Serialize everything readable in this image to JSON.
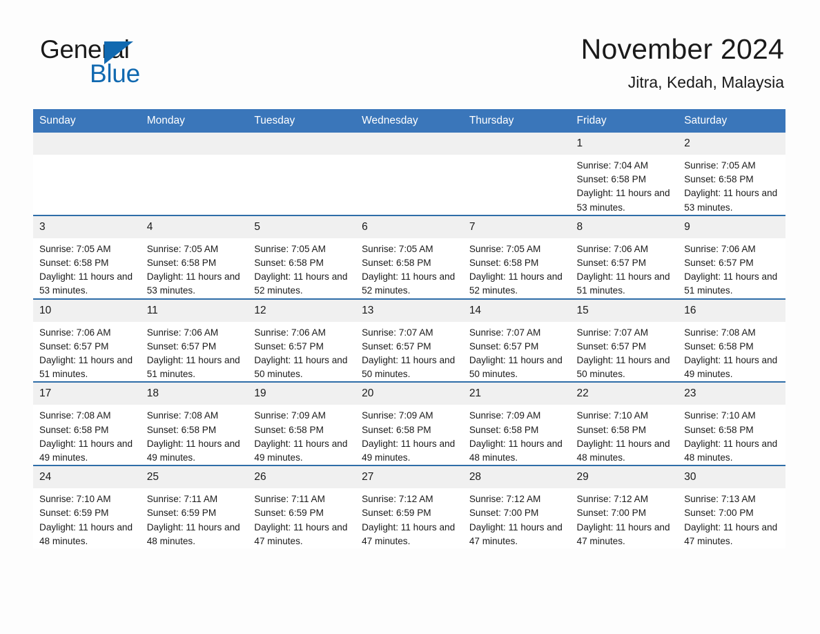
{
  "brand": {
    "name_part1": "General",
    "name_part2": "Blue",
    "logo_icon": "triangle-icon",
    "accent_color": "#1169b0"
  },
  "header": {
    "title": "November 2024",
    "subtitle": "Jitra, Kedah, Malaysia"
  },
  "colors": {
    "header_blue": "#3a76ba",
    "row_rule_blue": "#2e6da8",
    "daynum_band": "#f0f0f0"
  },
  "weekday_headers": [
    "Sunday",
    "Monday",
    "Tuesday",
    "Wednesday",
    "Thursday",
    "Friday",
    "Saturday"
  ],
  "weeks": [
    [
      {
        "day": "",
        "empty": true
      },
      {
        "day": "",
        "empty": true
      },
      {
        "day": "",
        "empty": true
      },
      {
        "day": "",
        "empty": true
      },
      {
        "day": "",
        "empty": true
      },
      {
        "day": "1",
        "sunrise": "Sunrise: 7:04 AM",
        "sunset": "Sunset: 6:58 PM",
        "daylight": "Daylight: 11 hours and 53 minutes."
      },
      {
        "day": "2",
        "sunrise": "Sunrise: 7:05 AM",
        "sunset": "Sunset: 6:58 PM",
        "daylight": "Daylight: 11 hours and 53 minutes."
      }
    ],
    [
      {
        "day": "3",
        "sunrise": "Sunrise: 7:05 AM",
        "sunset": "Sunset: 6:58 PM",
        "daylight": "Daylight: 11 hours and 53 minutes."
      },
      {
        "day": "4",
        "sunrise": "Sunrise: 7:05 AM",
        "sunset": "Sunset: 6:58 PM",
        "daylight": "Daylight: 11 hours and 53 minutes."
      },
      {
        "day": "5",
        "sunrise": "Sunrise: 7:05 AM",
        "sunset": "Sunset: 6:58 PM",
        "daylight": "Daylight: 11 hours and 52 minutes."
      },
      {
        "day": "6",
        "sunrise": "Sunrise: 7:05 AM",
        "sunset": "Sunset: 6:58 PM",
        "daylight": "Daylight: 11 hours and 52 minutes."
      },
      {
        "day": "7",
        "sunrise": "Sunrise: 7:05 AM",
        "sunset": "Sunset: 6:58 PM",
        "daylight": "Daylight: 11 hours and 52 minutes."
      },
      {
        "day": "8",
        "sunrise": "Sunrise: 7:06 AM",
        "sunset": "Sunset: 6:57 PM",
        "daylight": "Daylight: 11 hours and 51 minutes."
      },
      {
        "day": "9",
        "sunrise": "Sunrise: 7:06 AM",
        "sunset": "Sunset: 6:57 PM",
        "daylight": "Daylight: 11 hours and 51 minutes."
      }
    ],
    [
      {
        "day": "10",
        "sunrise": "Sunrise: 7:06 AM",
        "sunset": "Sunset: 6:57 PM",
        "daylight": "Daylight: 11 hours and 51 minutes."
      },
      {
        "day": "11",
        "sunrise": "Sunrise: 7:06 AM",
        "sunset": "Sunset: 6:57 PM",
        "daylight": "Daylight: 11 hours and 51 minutes."
      },
      {
        "day": "12",
        "sunrise": "Sunrise: 7:06 AM",
        "sunset": "Sunset: 6:57 PM",
        "daylight": "Daylight: 11 hours and 50 minutes."
      },
      {
        "day": "13",
        "sunrise": "Sunrise: 7:07 AM",
        "sunset": "Sunset: 6:57 PM",
        "daylight": "Daylight: 11 hours and 50 minutes."
      },
      {
        "day": "14",
        "sunrise": "Sunrise: 7:07 AM",
        "sunset": "Sunset: 6:57 PM",
        "daylight": "Daylight: 11 hours and 50 minutes."
      },
      {
        "day": "15",
        "sunrise": "Sunrise: 7:07 AM",
        "sunset": "Sunset: 6:57 PM",
        "daylight": "Daylight: 11 hours and 50 minutes."
      },
      {
        "day": "16",
        "sunrise": "Sunrise: 7:08 AM",
        "sunset": "Sunset: 6:58 PM",
        "daylight": "Daylight: 11 hours and 49 minutes."
      }
    ],
    [
      {
        "day": "17",
        "sunrise": "Sunrise: 7:08 AM",
        "sunset": "Sunset: 6:58 PM",
        "daylight": "Daylight: 11 hours and 49 minutes."
      },
      {
        "day": "18",
        "sunrise": "Sunrise: 7:08 AM",
        "sunset": "Sunset: 6:58 PM",
        "daylight": "Daylight: 11 hours and 49 minutes."
      },
      {
        "day": "19",
        "sunrise": "Sunrise: 7:09 AM",
        "sunset": "Sunset: 6:58 PM",
        "daylight": "Daylight: 11 hours and 49 minutes."
      },
      {
        "day": "20",
        "sunrise": "Sunrise: 7:09 AM",
        "sunset": "Sunset: 6:58 PM",
        "daylight": "Daylight: 11 hours and 49 minutes."
      },
      {
        "day": "21",
        "sunrise": "Sunrise: 7:09 AM",
        "sunset": "Sunset: 6:58 PM",
        "daylight": "Daylight: 11 hours and 48 minutes."
      },
      {
        "day": "22",
        "sunrise": "Sunrise: 7:10 AM",
        "sunset": "Sunset: 6:58 PM",
        "daylight": "Daylight: 11 hours and 48 minutes."
      },
      {
        "day": "23",
        "sunrise": "Sunrise: 7:10 AM",
        "sunset": "Sunset: 6:58 PM",
        "daylight": "Daylight: 11 hours and 48 minutes."
      }
    ],
    [
      {
        "day": "24",
        "sunrise": "Sunrise: 7:10 AM",
        "sunset": "Sunset: 6:59 PM",
        "daylight": "Daylight: 11 hours and 48 minutes."
      },
      {
        "day": "25",
        "sunrise": "Sunrise: 7:11 AM",
        "sunset": "Sunset: 6:59 PM",
        "daylight": "Daylight: 11 hours and 48 minutes."
      },
      {
        "day": "26",
        "sunrise": "Sunrise: 7:11 AM",
        "sunset": "Sunset: 6:59 PM",
        "daylight": "Daylight: 11 hours and 47 minutes."
      },
      {
        "day": "27",
        "sunrise": "Sunrise: 7:12 AM",
        "sunset": "Sunset: 6:59 PM",
        "daylight": "Daylight: 11 hours and 47 minutes."
      },
      {
        "day": "28",
        "sunrise": "Sunrise: 7:12 AM",
        "sunset": "Sunset: 7:00 PM",
        "daylight": "Daylight: 11 hours and 47 minutes."
      },
      {
        "day": "29",
        "sunrise": "Sunrise: 7:12 AM",
        "sunset": "Sunset: 7:00 PM",
        "daylight": "Daylight: 11 hours and 47 minutes."
      },
      {
        "day": "30",
        "sunrise": "Sunrise: 7:13 AM",
        "sunset": "Sunset: 7:00 PM",
        "daylight": "Daylight: 11 hours and 47 minutes."
      }
    ]
  ]
}
